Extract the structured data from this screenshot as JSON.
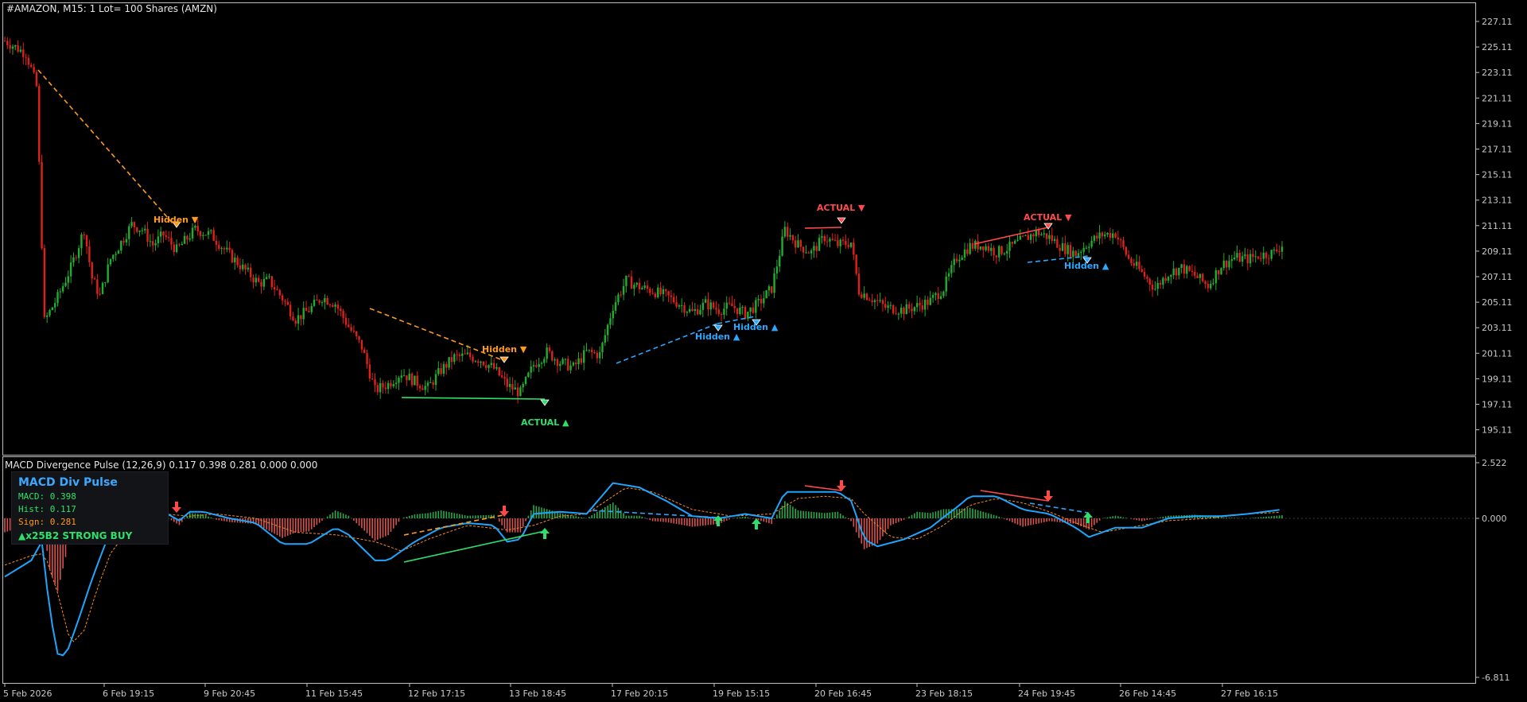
{
  "header": {
    "title": "#AMAZON, M15:  1 Lot= 100 Shares (AMZN)"
  },
  "indicator": {
    "title": "MACD Divergence Pulse (12,26,9) 0.117 0.398 0.281 0.000 0.000"
  },
  "panel": {
    "title": "MACD Div Pulse",
    "macd": "MACD: 0.398",
    "hist": "Hist: 0.117",
    "sign": "Sign: 0.281",
    "signal": "▲x25B2 STRONG BUY"
  },
  "colors": {
    "bull": "#1fae2e",
    "bear": "#e0201a",
    "orange": "#ff9a1a",
    "blue": "#2aa8ff",
    "green": "#2ee06a",
    "red": "#ff4a4a",
    "macd_line": "#1ea6ff",
    "signal_line": "#ff8c1a",
    "hist_pos": "#2aa84a",
    "hist_neg": "#d9534f",
    "grid_text": "#c8c8c8",
    "border": "#c0c0c0"
  },
  "chart_data": [
    {
      "type": "candlestick",
      "title": "#AMAZON, M15:  1 Lot= 100 Shares (AMZN)",
      "ylim": [
        193.5,
        228.5
      ],
      "price_ticks": [
        "227.11",
        "225.11",
        "223.11",
        "221.11",
        "219.11",
        "217.11",
        "215.11",
        "213.11",
        "211.11",
        "209.11",
        "207.11",
        "205.11",
        "203.11",
        "201.11",
        "199.11",
        "197.11",
        "195.11"
      ],
      "time_labels": [
        "5 Feb 2026",
        "6 Feb 19:15",
        "9 Feb 20:45",
        "11 Feb 15:45",
        "12 Feb 17:15",
        "13 Feb 18:45",
        "17 Feb 20:15",
        "19 Feb 15:15",
        "20 Feb 16:45",
        "23 Feb 18:15",
        "24 Feb 19:45",
        "26 Feb 14:45",
        "27 Feb 16:15"
      ],
      "bars_count": 340,
      "close_path": [
        [
          0,
          225.6
        ],
        [
          8,
          224.6
        ],
        [
          10,
          223.4
        ],
        [
          12,
          222.0
        ],
        [
          15,
          203.6
        ],
        [
          20,
          205.5
        ],
        [
          25,
          207.8
        ],
        [
          30,
          210.8
        ],
        [
          33,
          207.0
        ],
        [
          36,
          205.6
        ],
        [
          40,
          208.5
        ],
        [
          44,
          209.8
        ],
        [
          48,
          211.2
        ],
        [
          52,
          210.8
        ],
        [
          56,
          209.6
        ],
        [
          60,
          210.4
        ],
        [
          65,
          209.2
        ],
        [
          72,
          210.8
        ],
        [
          78,
          210.4
        ],
        [
          85,
          208.8
        ],
        [
          90,
          207.8
        ],
        [
          96,
          206.6
        ],
        [
          100,
          206.8
        ],
        [
          105,
          205.4
        ],
        [
          110,
          203.8
        ],
        [
          115,
          204.5
        ],
        [
          120,
          205.5
        ],
        [
          125,
          205.0
        ],
        [
          130,
          203.2
        ],
        [
          135,
          201.6
        ],
        [
          140,
          198.2
        ],
        [
          145,
          198.7
        ],
        [
          150,
          199.6
        ],
        [
          155,
          198.9
        ],
        [
          160,
          198.4
        ],
        [
          165,
          199.8
        ],
        [
          170,
          200.8
        ],
        [
          175,
          200.9
        ],
        [
          180,
          200.6
        ],
        [
          185,
          199.9
        ],
        [
          190,
          198.6
        ],
        [
          195,
          198.0
        ],
        [
          200,
          200.2
        ],
        [
          205,
          201.2
        ],
        [
          210,
          200.4
        ],
        [
          215,
          200.0
        ],
        [
          220,
          201.2
        ],
        [
          225,
          201.0
        ],
        [
          230,
          204.8
        ],
        [
          235,
          206.8
        ],
        [
          240,
          206.3
        ],
        [
          245,
          206.0
        ],
        [
          250,
          205.6
        ],
        [
          255,
          205.0
        ],
        [
          260,
          204.3
        ],
        [
          265,
          205.0
        ],
        [
          270,
          204.5
        ],
        [
          275,
          204.8
        ],
        [
          280,
          204.2
        ],
        [
          285,
          205.0
        ],
        [
          290,
          206.2
        ],
        [
          295,
          210.8
        ],
        [
          300,
          209.6
        ],
        [
          305,
          209.0
        ],
        [
          310,
          210.2
        ],
        [
          315,
          209.6
        ],
        [
          320,
          209.8
        ],
        [
          323,
          206.0
        ],
        [
          328,
          205.4
        ],
        [
          333,
          204.7
        ],
        [
          340,
          204.5
        ],
        [
          345,
          204.8
        ],
        [
          350,
          205.2
        ],
        [
          355,
          206.2
        ],
        [
          360,
          208.6
        ],
        [
          365,
          209.5
        ],
        [
          370,
          209.6
        ],
        [
          375,
          209.0
        ],
        [
          380,
          209.4
        ],
        [
          385,
          210.0
        ],
        [
          390,
          210.6
        ],
        [
          395,
          210.2
        ],
        [
          400,
          209.4
        ],
        [
          405,
          208.9
        ],
        [
          410,
          209.8
        ],
        [
          415,
          210.4
        ],
        [
          420,
          210.5
        ],
        [
          425,
          208.5
        ],
        [
          430,
          207.4
        ],
        [
          435,
          206.2
        ],
        [
          440,
          207.4
        ],
        [
          445,
          207.8
        ],
        [
          450,
          207.2
        ],
        [
          455,
          206.4
        ],
        [
          460,
          208.0
        ],
        [
          465,
          208.6
        ],
        [
          470,
          208.5
        ],
        [
          475,
          208.8
        ],
        [
          480,
          209.0
        ],
        [
          483,
          209.6
        ]
      ]
    },
    {
      "type": "line",
      "title": "MACD Divergence Pulse (12,26,9) 0.117 0.398 0.281 0.000 0.000",
      "ylim": [
        -6.811,
        2.522
      ],
      "ticks": [
        "2.522",
        "0.000",
        "-6.811"
      ],
      "series": [
        {
          "name": "MACD",
          "points": [
            [
              0,
              -2.5
            ],
            [
              10,
              -1.8
            ],
            [
              14,
              -1.0
            ],
            [
              17,
              -4.0
            ],
            [
              20,
              -5.8
            ],
            [
              23,
              -5.9
            ],
            [
              28,
              -4.3
            ],
            [
              33,
              -2.6
            ],
            [
              38,
              -1.1
            ],
            [
              45,
              0.1
            ],
            [
              52,
              0.5
            ],
            [
              60,
              0.3
            ],
            [
              66,
              -0.1
            ],
            [
              70,
              0.3
            ],
            [
              75,
              0.3
            ],
            [
              85,
              0.0
            ],
            [
              95,
              -0.2
            ],
            [
              105,
              -1.1
            ],
            [
              115,
              -1.1
            ],
            [
              125,
              -0.4
            ],
            [
              130,
              -0.7
            ],
            [
              140,
              -1.8
            ],
            [
              145,
              -1.8
            ],
            [
              155,
              -1.0
            ],
            [
              165,
              -0.4
            ],
            [
              175,
              -0.2
            ],
            [
              185,
              -0.3
            ],
            [
              190,
              -1.0
            ],
            [
              195,
              -0.9
            ],
            [
              200,
              0.2
            ],
            [
              210,
              0.3
            ],
            [
              220,
              0.2
            ],
            [
              230,
              1.6
            ],
            [
              240,
              1.4
            ],
            [
              250,
              0.8
            ],
            [
              260,
              0.1
            ],
            [
              270,
              0.0
            ],
            [
              280,
              0.2
            ],
            [
              290,
              0.0
            ],
            [
              295,
              1.2
            ],
            [
              305,
              1.2
            ],
            [
              315,
              1.2
            ],
            [
              320,
              0.8
            ],
            [
              325,
              -0.9
            ],
            [
              330,
              -1.2
            ],
            [
              340,
              -0.9
            ],
            [
              350,
              -0.4
            ],
            [
              360,
              0.5
            ],
            [
              365,
              1.0
            ],
            [
              375,
              1.0
            ],
            [
              385,
              0.4
            ],
            [
              395,
              0.2
            ],
            [
              405,
              -0.4
            ],
            [
              410,
              -0.8
            ],
            [
              420,
              -0.4
            ],
            [
              430,
              -0.4
            ],
            [
              440,
              0.0
            ],
            [
              450,
              0.1
            ],
            [
              460,
              0.1
            ],
            [
              470,
              0.2
            ],
            [
              483,
              0.4
            ]
          ]
        },
        {
          "name": "Signal",
          "points": [
            [
              0,
              -2.0
            ],
            [
              10,
              -1.6
            ],
            [
              15,
              -1.5
            ],
            [
              20,
              -3.2
            ],
            [
              25,
              -5.4
            ],
            [
              30,
              -4.8
            ],
            [
              35,
              -3.0
            ],
            [
              40,
              -1.5
            ],
            [
              50,
              0.0
            ],
            [
              60,
              0.2
            ],
            [
              70,
              0.1
            ],
            [
              80,
              0.2
            ],
            [
              95,
              0.0
            ],
            [
              110,
              -0.6
            ],
            [
              125,
              -0.7
            ],
            [
              140,
              -1.0
            ],
            [
              150,
              -1.4
            ],
            [
              160,
              -0.9
            ],
            [
              175,
              -0.3
            ],
            [
              190,
              -0.5
            ],
            [
              200,
              -0.3
            ],
            [
              210,
              0.1
            ],
            [
              220,
              0.2
            ],
            [
              235,
              1.4
            ],
            [
              245,
              1.2
            ],
            [
              260,
              0.4
            ],
            [
              275,
              0.1
            ],
            [
              290,
              0.2
            ],
            [
              300,
              0.9
            ],
            [
              310,
              1.0
            ],
            [
              320,
              0.9
            ],
            [
              325,
              0.2
            ],
            [
              335,
              -0.8
            ],
            [
              345,
              -0.9
            ],
            [
              355,
              -0.3
            ],
            [
              365,
              0.6
            ],
            [
              375,
              0.9
            ],
            [
              385,
              0.7
            ],
            [
              395,
              0.3
            ],
            [
              405,
              -0.2
            ],
            [
              415,
              -0.6
            ],
            [
              425,
              -0.4
            ],
            [
              440,
              -0.1
            ],
            [
              455,
              0.0
            ],
            [
              470,
              0.2
            ],
            [
              483,
              0.281
            ]
          ]
        }
      ],
      "zero_line": 0.0
    }
  ],
  "annotations": {
    "hidden_bear_1": "Hidden ▼",
    "hidden_bear_2": "Hidden ▼",
    "actual_bull": "ACTUAL ▲",
    "hidden_bull_1": "Hidden ▲",
    "hidden_bull_2": "Hidden ▲",
    "actual_bear_1": "ACTUAL ▼",
    "actual_bear_2": "ACTUAL ▼",
    "hidden_bull_3": "Hidden ▲"
  }
}
